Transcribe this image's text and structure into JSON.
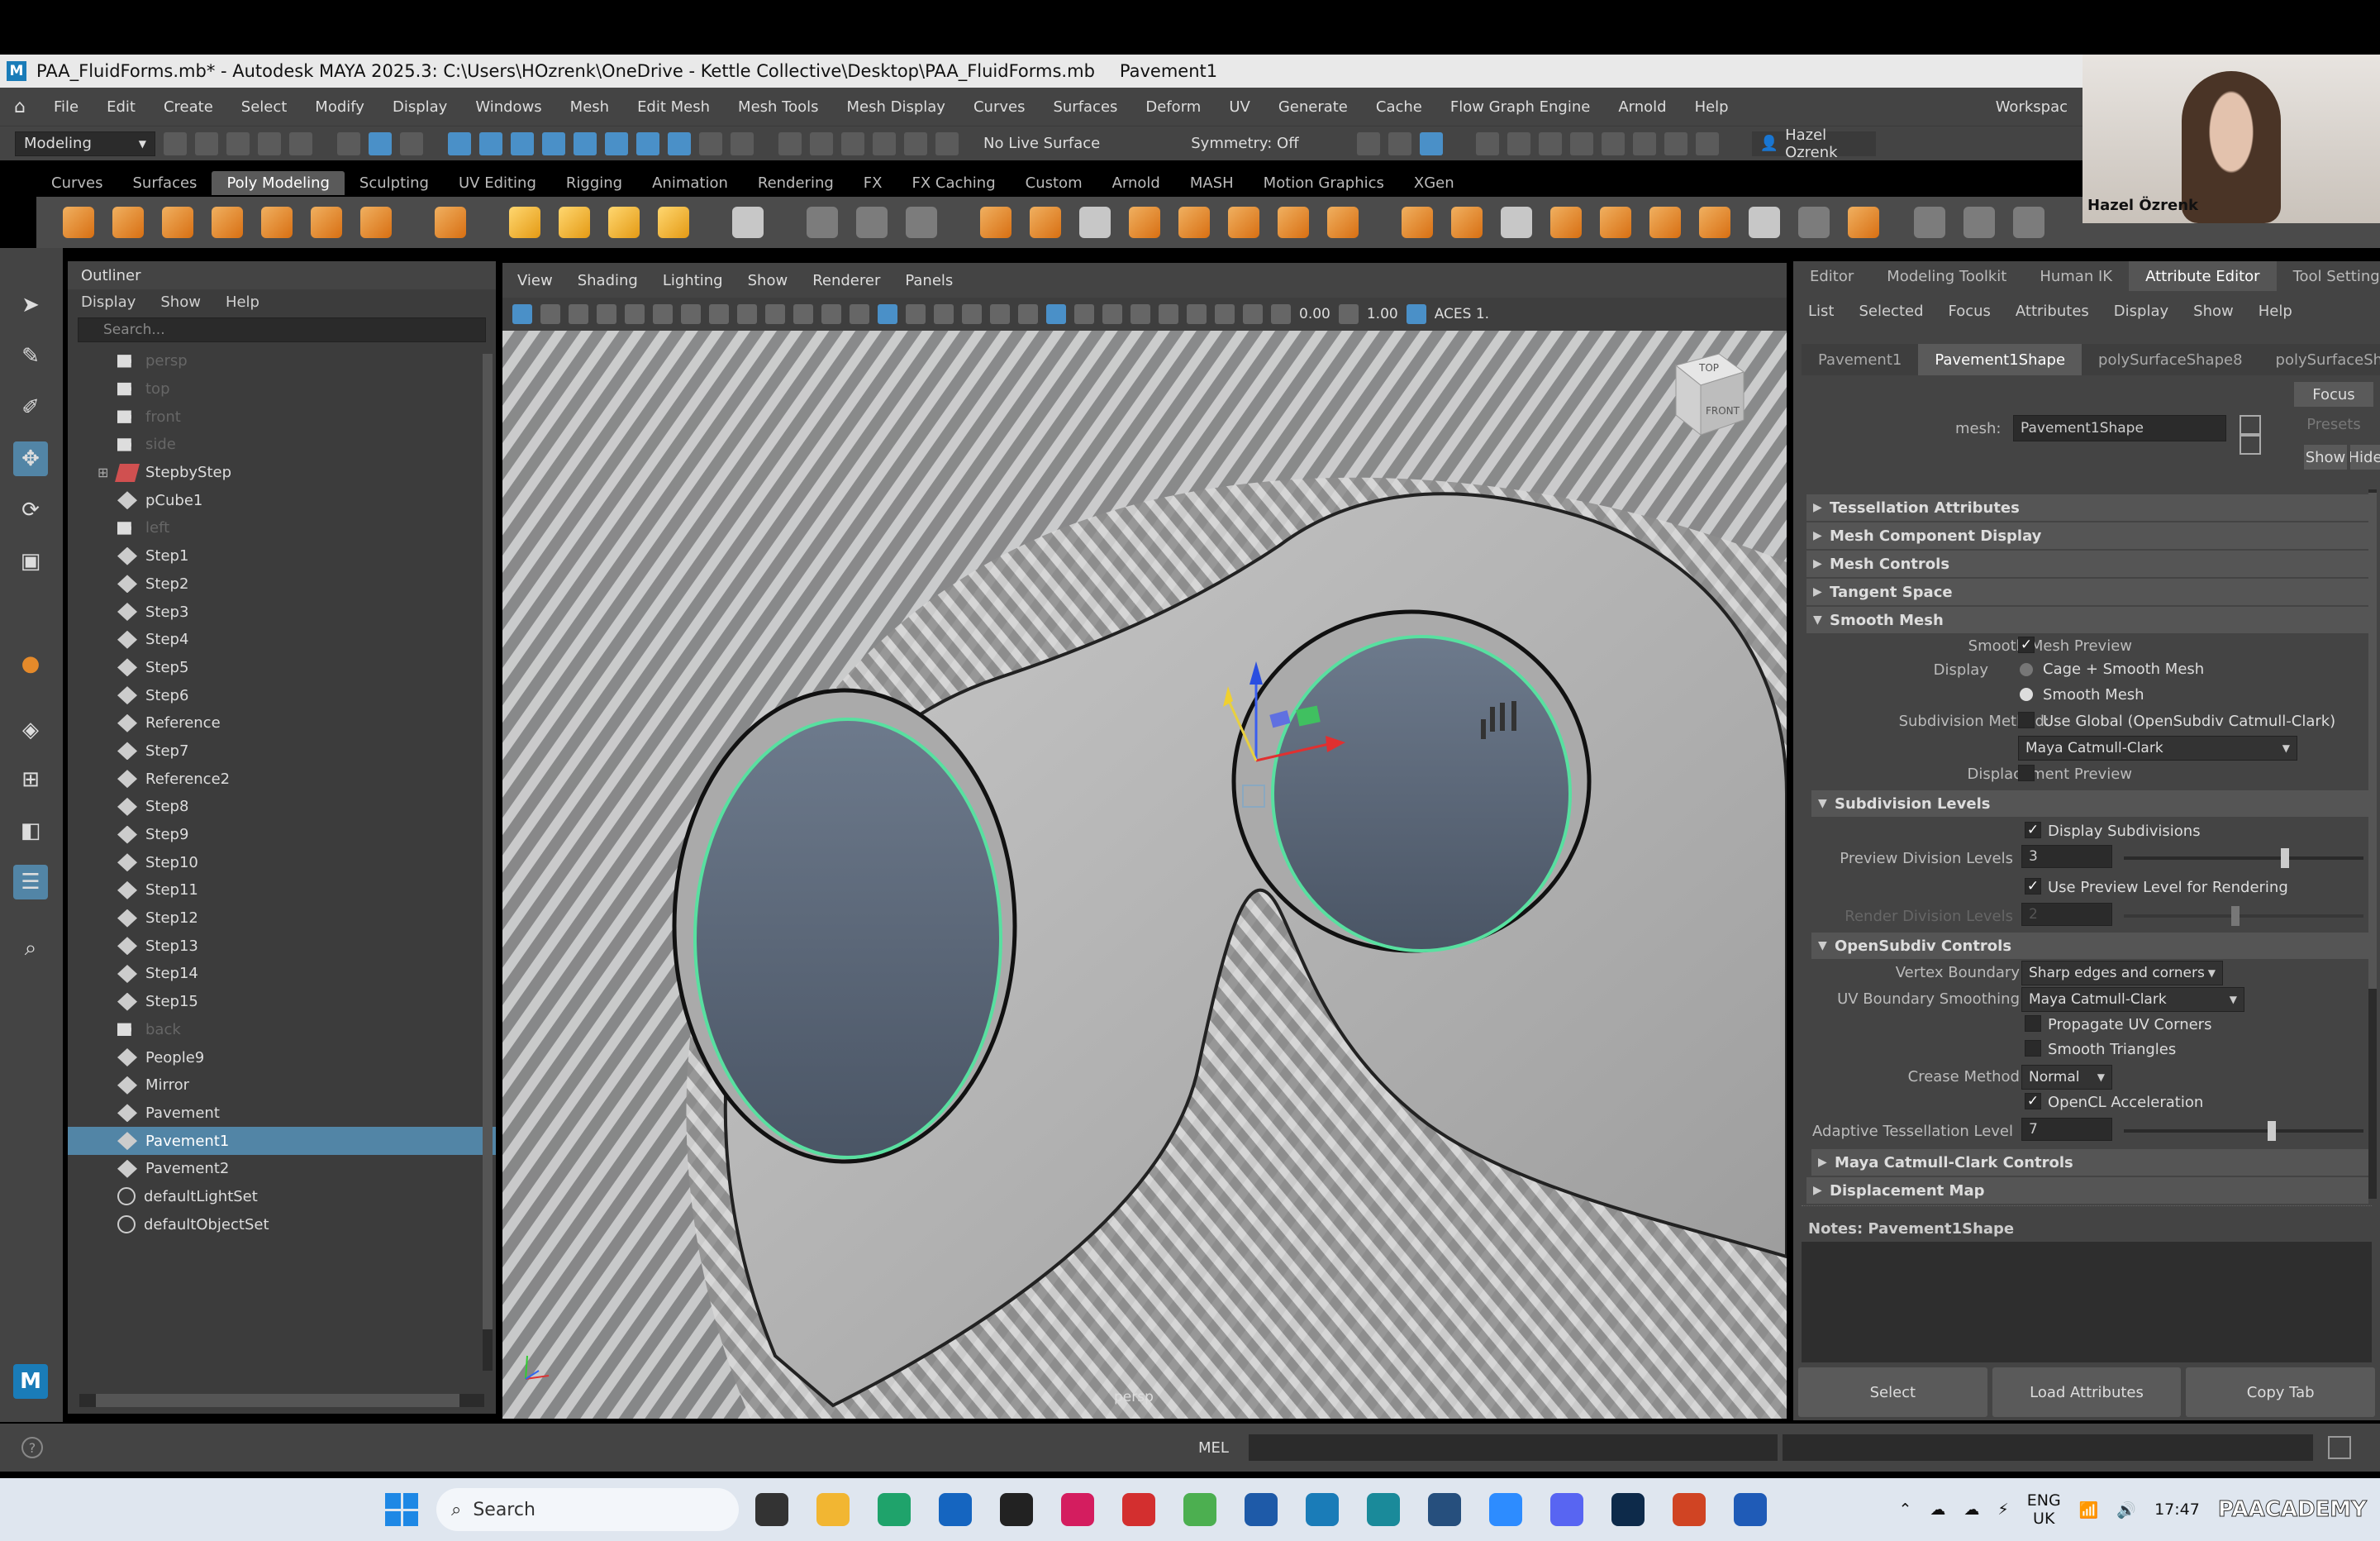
{
  "window": {
    "title": "PAA_FluidForms.mb* - Autodesk MAYA 2025.3: C:\\Users\\HOzrenk\\OneDrive - Kettle Collective\\Desktop\\PAA_FluidForms.mb",
    "selection": "Pavement1"
  },
  "menu": [
    "File",
    "Edit",
    "Create",
    "Select",
    "Modify",
    "Display",
    "Windows",
    "Mesh",
    "Edit Mesh",
    "Mesh Tools",
    "Mesh Display",
    "Curves",
    "Surfaces",
    "Deform",
    "UV",
    "Generate",
    "Cache",
    "Flow Graph Engine",
    "Arnold",
    "Help"
  ],
  "menu_right": "Workspac",
  "status": {
    "menuset": "Modeling",
    "live_surface": "No Live Surface",
    "symmetry": "Symmetry: Off",
    "user": "Hazel Ozrenk"
  },
  "shelf_tabs": [
    "Curves",
    "Surfaces",
    "Poly Modeling",
    "Sculpting",
    "UV Editing",
    "Rigging",
    "Animation",
    "Rendering",
    "FX",
    "FX Caching",
    "Custom",
    "Arnold",
    "MASH",
    "Motion Graphics",
    "XGen"
  ],
  "shelf_active": "Poly Modeling",
  "outliner": {
    "title": "Outliner",
    "menu": [
      "Display",
      "Show",
      "Help"
    ],
    "search_placeholder": "Search...",
    "items": [
      {
        "name": "persp",
        "icon": "camera",
        "dim": true
      },
      {
        "name": "top",
        "icon": "camera",
        "dim": true
      },
      {
        "name": "front",
        "icon": "camera",
        "dim": true
      },
      {
        "name": "side",
        "icon": "camera",
        "dim": true
      },
      {
        "name": "StepbyStep",
        "icon": "group",
        "expand": true
      },
      {
        "name": "pCube1",
        "icon": "mesh"
      },
      {
        "name": "left",
        "icon": "camera",
        "dim": true
      },
      {
        "name": "Step1",
        "icon": "mesh"
      },
      {
        "name": "Step2",
        "icon": "mesh"
      },
      {
        "name": "Step3",
        "icon": "mesh"
      },
      {
        "name": "Step4",
        "icon": "mesh"
      },
      {
        "name": "Step5",
        "icon": "mesh"
      },
      {
        "name": "Step6",
        "icon": "mesh"
      },
      {
        "name": "Reference",
        "icon": "mesh"
      },
      {
        "name": "Step7",
        "icon": "mesh"
      },
      {
        "name": "Reference2",
        "icon": "mesh"
      },
      {
        "name": "Step8",
        "icon": "mesh"
      },
      {
        "name": "Step9",
        "icon": "mesh"
      },
      {
        "name": "Step10",
        "icon": "mesh"
      },
      {
        "name": "Step11",
        "icon": "mesh"
      },
      {
        "name": "Step12",
        "icon": "mesh"
      },
      {
        "name": "Step13",
        "icon": "mesh"
      },
      {
        "name": "Step14",
        "icon": "mesh"
      },
      {
        "name": "Step15",
        "icon": "mesh"
      },
      {
        "name": "back",
        "icon": "camera",
        "dim": true
      },
      {
        "name": "People9",
        "icon": "mesh"
      },
      {
        "name": "Mirror",
        "icon": "mesh"
      },
      {
        "name": "Pavement",
        "icon": "mesh"
      },
      {
        "name": "Pavement1",
        "icon": "mesh",
        "selected": true
      },
      {
        "name": "Pavement2",
        "icon": "mesh"
      },
      {
        "name": "defaultLightSet",
        "icon": "set"
      },
      {
        "name": "defaultObjectSet",
        "icon": "set"
      }
    ]
  },
  "viewport": {
    "menu": [
      "View",
      "Shading",
      "Lighting",
      "Show",
      "Renderer",
      "Panels"
    ],
    "exposure": "0.00",
    "gamma": "1.00",
    "colorspace": "ACES 1.",
    "camera_label": "persp",
    "cube_top": "TOP",
    "cube_front": "FRONT"
  },
  "attr_editor": {
    "tabs": [
      "Editor",
      "Modeling Toolkit",
      "Human IK",
      "Attribute Editor",
      "Tool Settings"
    ],
    "active_tab": "Attribute Editor",
    "menu": [
      "List",
      "Selected",
      "Focus",
      "Attributes",
      "Display",
      "Show",
      "Help"
    ],
    "nodes": [
      "Pavement1",
      "Pavement1Shape",
      "polySurfaceShape8",
      "polySurfaceShape"
    ],
    "active_node": "Pavement1Shape",
    "mesh_label": "mesh:",
    "mesh_value": "Pavement1Shape",
    "focus": "Focus",
    "presets": "Presets",
    "show": "Show",
    "hide": "Hide",
    "sections": [
      "Tessellation Attributes",
      "Mesh Component Display",
      "Mesh Controls",
      "Tangent Space",
      "Smooth Mesh"
    ],
    "smooth_preview_label": "Smooth Mesh Preview",
    "display_label": "Display",
    "opt_cage": "Cage + Smooth Mesh",
    "opt_smooth": "Smooth Mesh",
    "subdiv_method_label": "Subdivision Method:",
    "use_global": "Use Global (OpenSubdiv Catmull-Clark)",
    "method_value": "Maya Catmull-Clark",
    "displacement_preview": "Displacement Preview",
    "subdiv_levels": "Subdivision Levels",
    "display_subdivisions": "Display Subdivisions",
    "preview_levels_label": "Preview Division Levels",
    "preview_levels_value": "3",
    "use_preview": "Use Preview Level for Rendering",
    "render_levels_label": "Render Division Levels",
    "render_levels_value": "2",
    "opensubdiv": "OpenSubdiv Controls",
    "vertex_boundary_label": "Vertex Boundary",
    "vertex_boundary_value": "Sharp edges and corners",
    "uv_smoothing_label": "UV Boundary Smoothing",
    "uv_smoothing_value": "Maya Catmull-Clark",
    "propagate": "Propagate UV Corners",
    "smooth_tri": "Smooth Triangles",
    "crease_label": "Crease Method",
    "crease_value": "Normal",
    "opencl": "OpenCL Acceleration",
    "adaptive_label": "Adaptive Tessellation Level",
    "adaptive_value": "7",
    "catmull_controls": "Maya Catmull-Clark Controls",
    "displacement_map": "Displacement Map",
    "notes": "Notes:  Pavement1Shape",
    "buttons": [
      "Select",
      "Load Attributes",
      "Copy Tab"
    ]
  },
  "cmd": {
    "lang": "MEL"
  },
  "taskbar": {
    "search": "Search",
    "lang1": "ENG",
    "lang2": "UK",
    "time": "17:47",
    "watermark": "PAACADEMY"
  },
  "webcam": {
    "name": "Hazel Özrenk"
  }
}
